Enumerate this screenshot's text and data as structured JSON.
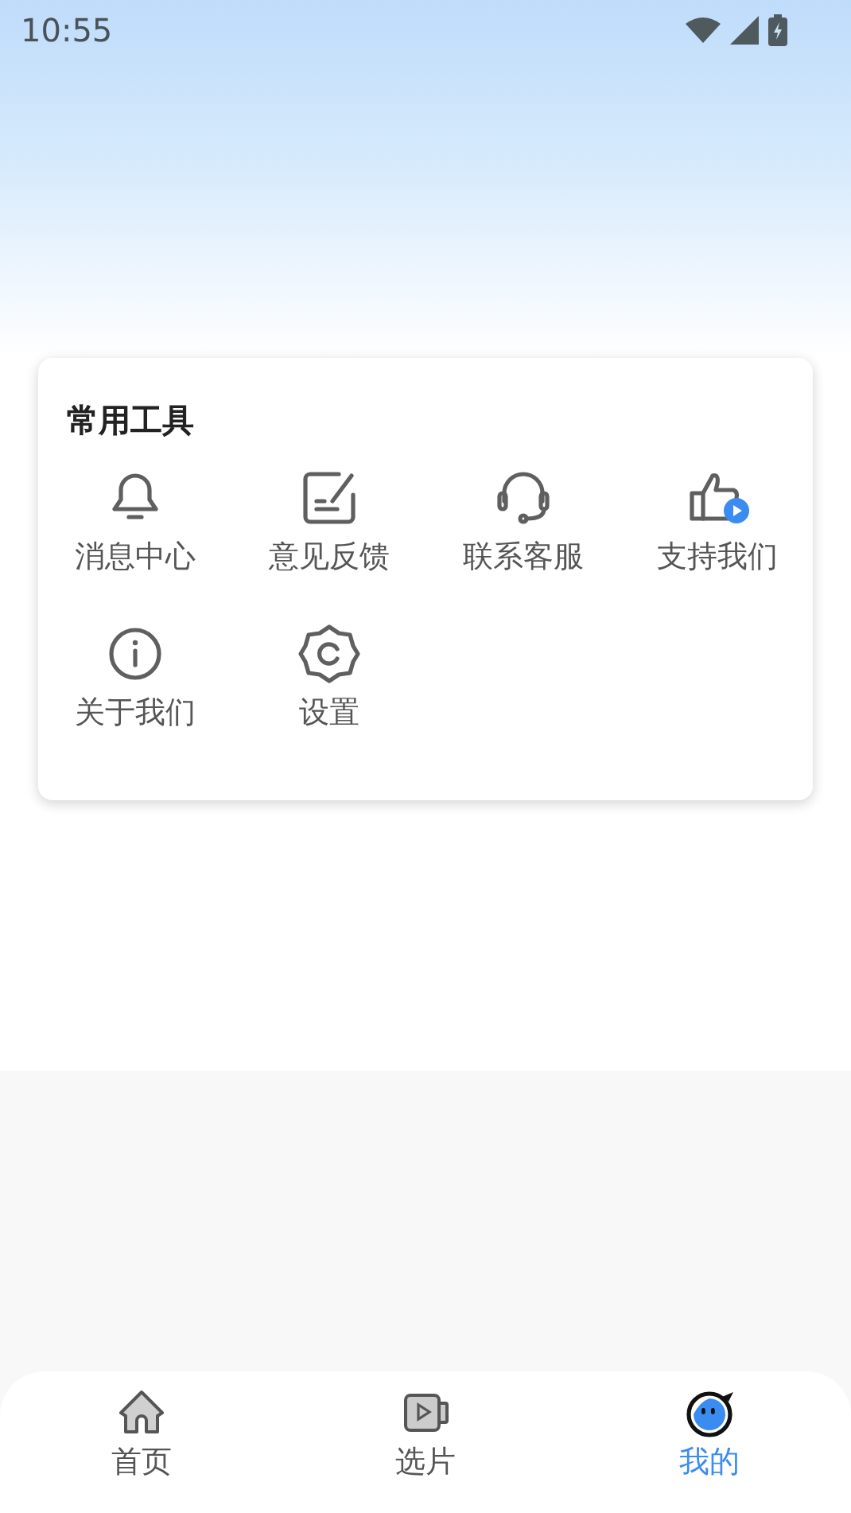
{
  "status_bar": {
    "time": "10:55"
  },
  "tools": {
    "title": "常用工具",
    "items": [
      {
        "label": "消息中心",
        "kind": "bell"
      },
      {
        "label": "意见反馈",
        "kind": "feedback"
      },
      {
        "label": "联系客服",
        "kind": "headset"
      },
      {
        "label": "支持我们",
        "kind": "thumb"
      },
      {
        "label": "关于我们",
        "kind": "info"
      },
      {
        "label": "设置",
        "kind": "settings"
      }
    ]
  },
  "nav": [
    {
      "label": "首页",
      "kind": "home",
      "selected": false
    },
    {
      "label": "选片",
      "kind": "video",
      "selected": false
    },
    {
      "label": "我的",
      "kind": "me",
      "selected": true
    }
  ]
}
